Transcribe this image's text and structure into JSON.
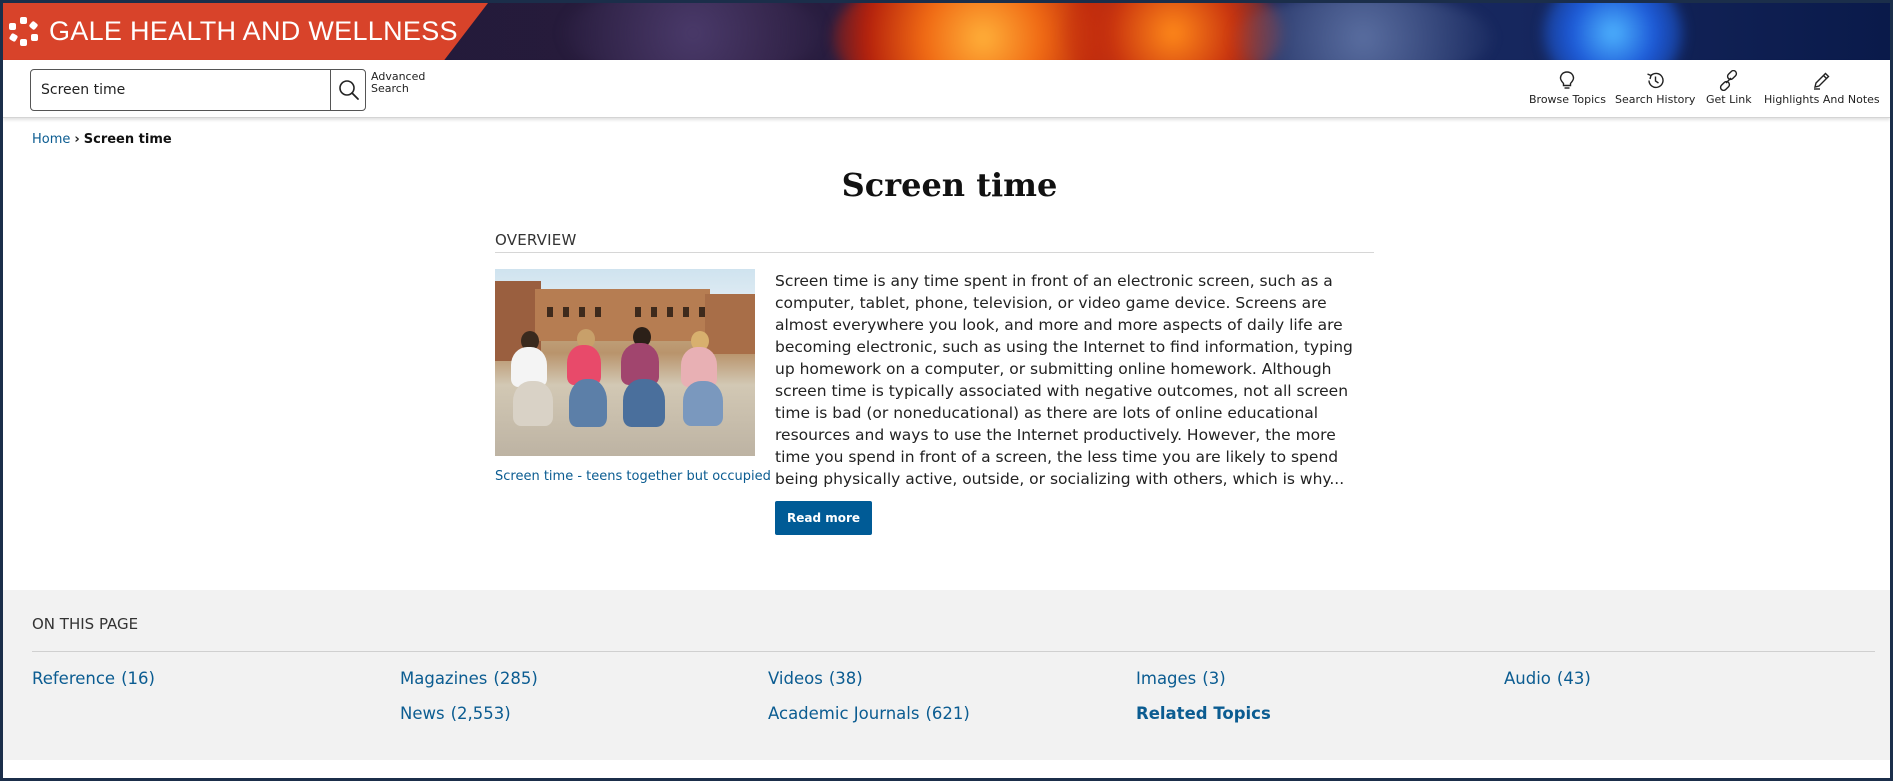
{
  "brand": {
    "title": "GALE HEALTH AND WELLNESS"
  },
  "search": {
    "value": "Screen time",
    "advanced_label": "Advanced Search"
  },
  "toolbar": {
    "browse_topics": "Browse Topics",
    "search_history": "Search History",
    "get_link": "Get Link",
    "highlights_notes": "Highlights And Notes"
  },
  "breadcrumb": {
    "home": "Home",
    "current": "Screen time"
  },
  "page": {
    "title": "Screen time",
    "overview_label": "OVERVIEW",
    "image_caption": "Screen time - teens together but occupied",
    "summary": "Screen time is any time spent in front of an electronic screen, such as a computer, tablet, phone, television, or video game device. Screens are almost everywhere you look, and more and more aspects of daily life are becoming electronic, such as using the Internet to find information, typing up homework on a computer, or submitting online homework. Although screen time is typically associated with negative outcomes, not all screen time is bad (or noneducational) as there are lots of online educational resources and ways to use the Internet productively. However, the more time you spend in front of a screen, the less time you are likely to spend being physically active, outside, or socializing with others, which is why...",
    "read_more": "Read more"
  },
  "on_this_page": {
    "title": "ON THIS PAGE",
    "links": [
      {
        "label": "Reference",
        "count": "(16)"
      },
      {
        "label": "Magazines",
        "count": "(285)"
      },
      {
        "label": "Videos",
        "count": "(38)"
      },
      {
        "label": "Images",
        "count": "(3)"
      },
      {
        "label": "Audio",
        "count": "(43)"
      },
      {
        "label": "News",
        "count": "(2,553)"
      },
      {
        "label": "Academic Journals",
        "count": "(621)"
      },
      {
        "label": "Related Topics"
      }
    ]
  },
  "colors": {
    "brand": "#d8432a",
    "link": "#0b5c91",
    "button": "#005b96",
    "section_bg": "#f2f2f2"
  },
  "icons": [
    "gale-logo-icon",
    "search-icon",
    "lightbulb-icon",
    "history-icon",
    "link-icon",
    "pencil-icon",
    "chevron-right-icon"
  ]
}
